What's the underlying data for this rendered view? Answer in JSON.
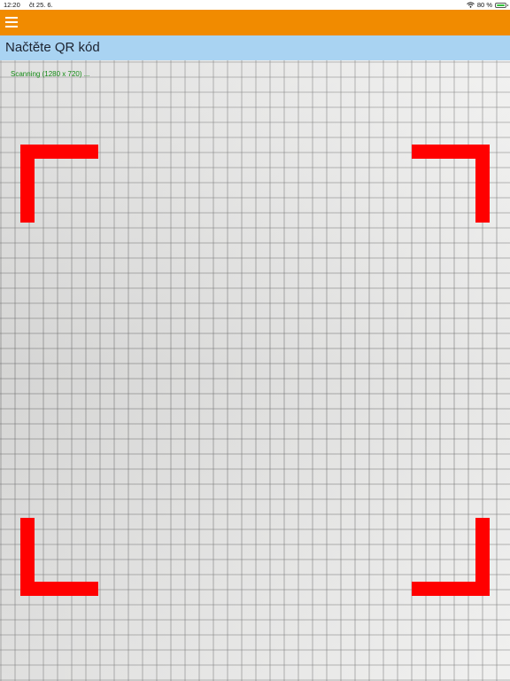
{
  "status_bar": {
    "time": "12:20",
    "date": "čt 25. 6.",
    "battery": "80 %",
    "wifi_icon": "wifi-icon",
    "battery_icon": "battery-icon"
  },
  "app_bar": {
    "color": "#f18b00",
    "menu_icon": "hamburger-menu-icon"
  },
  "header": {
    "title": "Načtěte QR kód",
    "color": "#a9d3f2"
  },
  "scanner": {
    "status": "Scanning (1280 x 720) ...",
    "frame_color": "#ff0000"
  }
}
